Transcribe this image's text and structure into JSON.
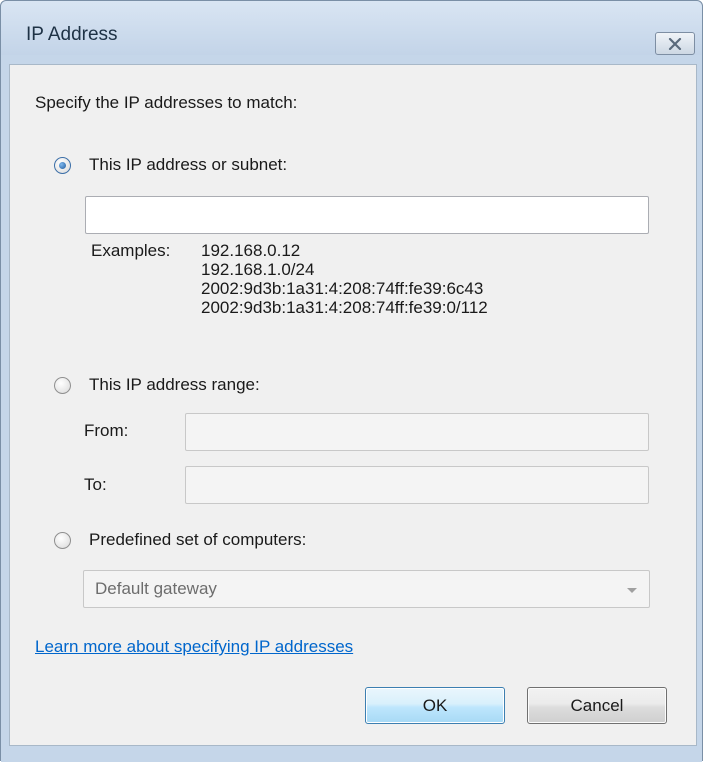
{
  "window": {
    "title": "IP Address"
  },
  "dialog": {
    "instruction": "Specify the IP addresses to match:",
    "option_subnet": {
      "label": "This IP address or subnet:",
      "selected": true,
      "value": "",
      "examples_label": "Examples:",
      "examples": [
        "192.168.0.12",
        "192.168.1.0/24",
        "2002:9d3b:1a31:4:208:74ff:fe39:6c43",
        "2002:9d3b:1a31:4:208:74ff:fe39:0/112"
      ]
    },
    "option_range": {
      "label": "This IP address range:",
      "selected": false,
      "from_label": "From:",
      "from_value": "",
      "to_label": "To:",
      "to_value": ""
    },
    "option_predefined": {
      "label": "Predefined set of computers:",
      "selected": false,
      "selected_value": "Default gateway"
    },
    "learn_more_link": "Learn more about specifying IP addresses",
    "ok_label": "OK",
    "cancel_label": "Cancel"
  },
  "icons": {
    "close": "close-icon",
    "dropdown": "chevron-down-icon"
  },
  "colors": {
    "link": "#0066cc",
    "radio_selected": "#1f5a9c",
    "ok_border": "#3c7fb1"
  }
}
